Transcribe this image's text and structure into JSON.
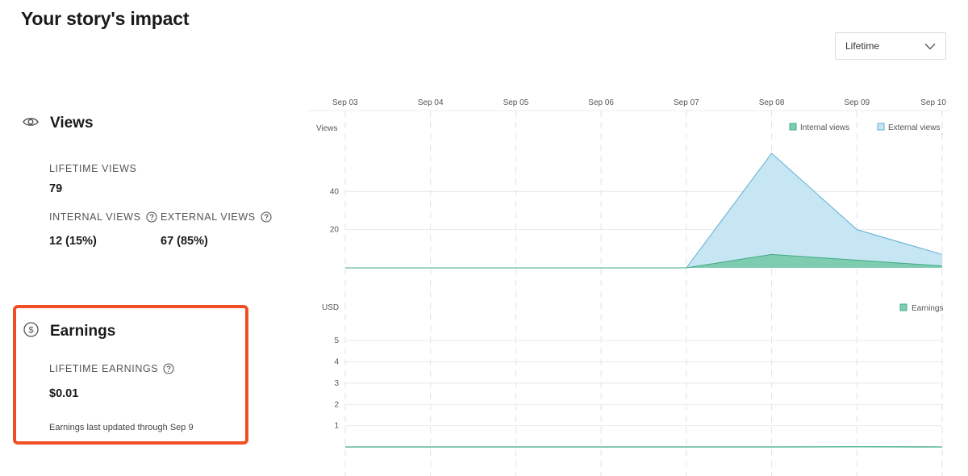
{
  "page": {
    "title": "Your story's impact"
  },
  "range_select": {
    "value": "Lifetime"
  },
  "views": {
    "heading": "Views",
    "lifetime_label": "LIFETIME VIEWS",
    "lifetime_value": "79",
    "internal_label": "INTERNAL VIEWS",
    "internal_value": "12 (15%)",
    "external_label": "EXTERNAL VIEWS",
    "external_value": "67 (85%)"
  },
  "earnings": {
    "heading": "Earnings",
    "lifetime_label": "LIFETIME EARNINGS",
    "lifetime_value": "$0.01",
    "note": "Earnings last updated through Sep 9"
  },
  "colors": {
    "internal_fill": "#7fcdb0",
    "internal_stroke": "#3daa82",
    "external_fill": "#c7e6f4",
    "external_stroke": "#5eaed3",
    "highlight": "#f04e23"
  },
  "chart_data": [
    {
      "type": "area",
      "x": [
        "Sep 03",
        "Sep 04",
        "Sep 05",
        "Sep 06",
        "Sep 07",
        "Sep 08",
        "Sep 09",
        "Sep 10"
      ],
      "ylabel": "Views",
      "yticks": [
        20,
        40
      ],
      "ylim": [
        0,
        60
      ],
      "grid": true,
      "legend_position": "top-right",
      "series": [
        {
          "name": "Internal views",
          "values": [
            0,
            0,
            0,
            0,
            0,
            7,
            4,
            1
          ]
        },
        {
          "name": "External views",
          "values": [
            0,
            0,
            0,
            0,
            0,
            53,
            16,
            6
          ]
        }
      ]
    },
    {
      "type": "line",
      "x": [
        "Sep 03",
        "Sep 04",
        "Sep 05",
        "Sep 06",
        "Sep 07",
        "Sep 08",
        "Sep 09",
        "Sep 10"
      ],
      "ylabel": "USD",
      "yticks": [
        1,
        2,
        3,
        4,
        5
      ],
      "ylim": [
        0,
        5.5
      ],
      "grid": true,
      "legend_position": "top-right",
      "series": [
        {
          "name": "Earnings",
          "values": [
            0,
            0,
            0,
            0,
            0,
            0,
            0.01,
            0
          ]
        }
      ]
    }
  ]
}
